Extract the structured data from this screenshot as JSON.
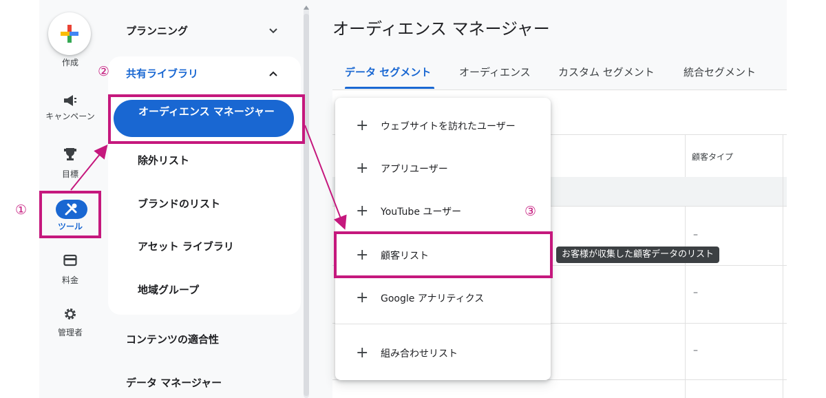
{
  "rail": {
    "create_label": "作成",
    "campaign_label": "キャンペーン",
    "goals_label": "目標",
    "tools_label": "ツール",
    "billing_label": "料金",
    "admin_label": "管理者"
  },
  "nav": {
    "planning": "プランニング",
    "shared_library": "共有ライブラリ",
    "sub_items": [
      "オーディエンス マネージャー",
      "除外リスト",
      "ブランドのリスト",
      "アセット ライブラリ",
      "地域グループ"
    ],
    "content_suitability": "コンテンツの適合性",
    "data_manager": "データ マネージャー"
  },
  "main": {
    "title": "オーディエンス マネージャー",
    "tabs": [
      "データ セグメント",
      "オーディエンス",
      "カスタム セグメント",
      "統合セグメント"
    ],
    "column_header": "顧客タイプ",
    "row_values": [
      "–",
      "–",
      "–"
    ]
  },
  "menu": {
    "items": [
      "ウェブサイトを訪れたユーザー",
      "アプリユーザー",
      "YouTube ユーザー",
      "顧客リスト",
      "Google アナリティクス",
      "組み合わせリスト"
    ],
    "tooltip": "お客様が収集した顧客データのリスト"
  },
  "annotations": {
    "step1": "①",
    "step2": "②",
    "step3": "③",
    "color": "#c5187d"
  },
  "colors": {
    "accent": "#1967d2",
    "annotation": "#c5187d"
  },
  "icons": [
    "plus-icon",
    "megaphone-icon",
    "trophy-icon",
    "tools-icon",
    "card-icon",
    "gear-icon",
    "chevron-down-icon",
    "chevron-up-icon"
  ]
}
